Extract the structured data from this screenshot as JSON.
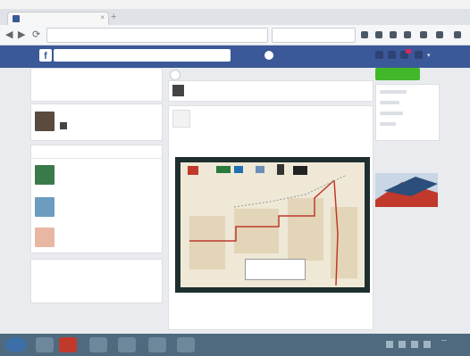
{
  "browser": {
    "menu": [
      "",
      "",
      "",
      "",
      "",
      "",
      ""
    ],
    "tab_title": "",
    "tab_close": "×",
    "new_tab": "+",
    "url": "",
    "search_placeholder": "",
    "nav": {
      "back": "◀",
      "forward": "▶",
      "reload": "⟳"
    }
  },
  "facebook": {
    "logo": "f",
    "search_value": "",
    "topnav": [
      "",
      "",
      "",
      ""
    ],
    "left_feed": {
      "item1_meta": "",
      "item2_text": "",
      "section_title": "",
      "groups": [
        {
          "name": "",
          "action": ""
        },
        {
          "name": "",
          "action": ""
        },
        {
          "name": "",
          "action": ""
        }
      ],
      "footer_text": ""
    },
    "composer_placeholder": "",
    "post": {
      "author": "",
      "meta": "",
      "text": "",
      "map_caption": "",
      "actions": [
        "",
        "",
        ""
      ]
    },
    "right": {
      "button": "",
      "section_title": "",
      "ad_title": "",
      "ad_text": "",
      "ad_link": ""
    }
  },
  "taskbar": {
    "clock": "—"
  },
  "colors": {
    "fb_blue": "#3b5998",
    "link": "#8b9dc3",
    "green_button": "#42b72a"
  }
}
